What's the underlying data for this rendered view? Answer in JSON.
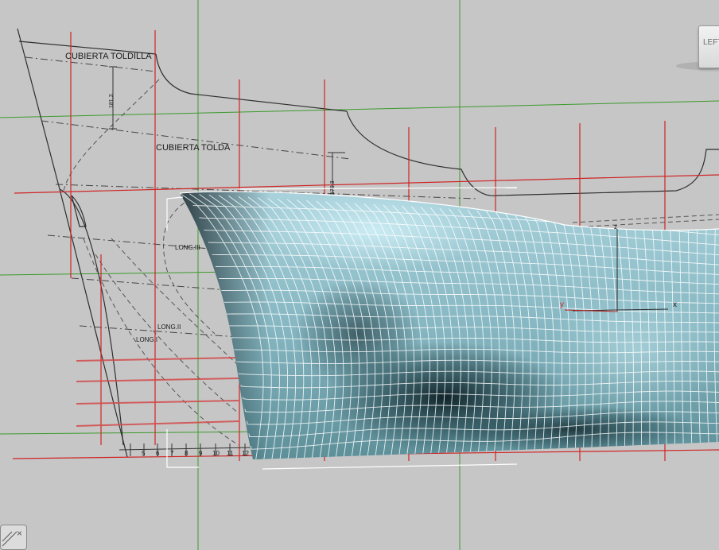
{
  "viewport": {
    "name": "Left orthographic viewport",
    "colors": {
      "background": "#c6c6c6",
      "grid_green": "#3c9a2c",
      "station_red": "#d02424",
      "mesh_wire": "#ffffff",
      "hull_surface": "#8fbcc6"
    }
  },
  "blueprint": {
    "deck_upper_label": "CUBIERTA TOLDILLA",
    "deck_lower_label": "CUBIERTA TOLDA",
    "dim_label_1": "181,3",
    "dim_label_2": "170,3",
    "long_labels": [
      "LONG.III",
      "LONG.II",
      "LONG.I"
    ],
    "station_numbers": [
      "5",
      "6",
      "7",
      "8",
      "9",
      "10",
      "11",
      "12"
    ]
  },
  "gizmo": {
    "axis_x": "x",
    "axis_y": "y",
    "axis_z": "z"
  },
  "viewcube": {
    "label": "LEFT",
    "icon": "viewcube-icon"
  },
  "corner_widget": {
    "icon": "close-icon",
    "glyph": "×"
  }
}
